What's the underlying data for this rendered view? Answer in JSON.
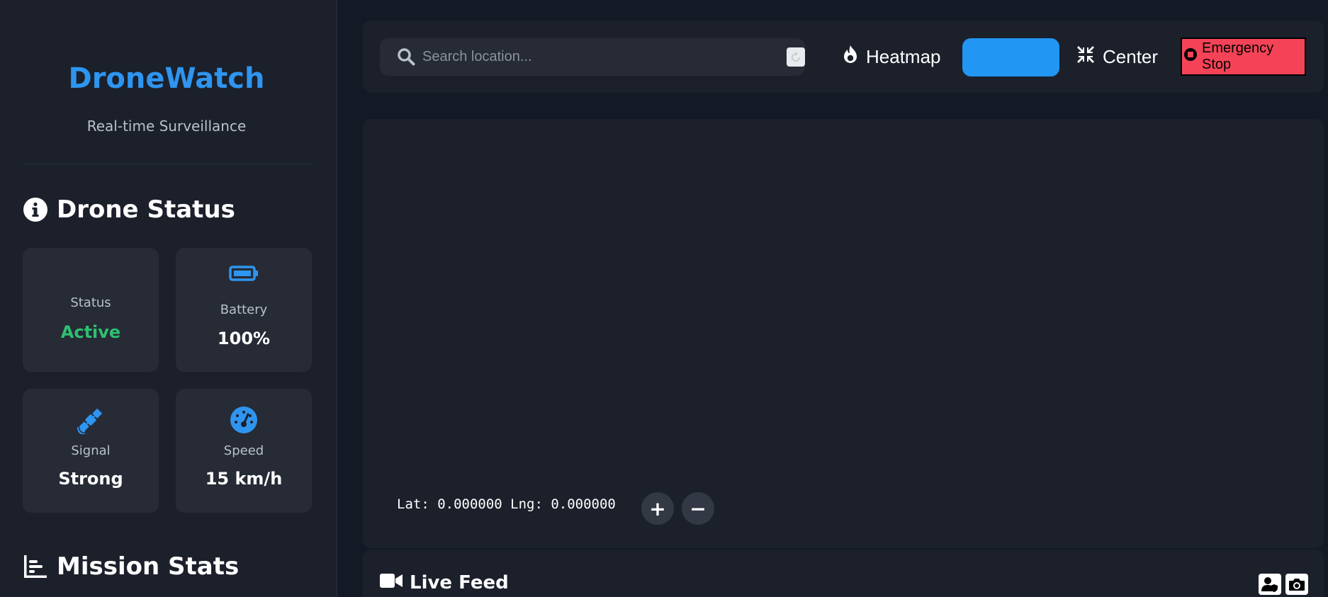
{
  "sidebar": {
    "brand": "DroneWatch",
    "tagline": "Real-time Surveillance",
    "status_section": {
      "title": "Drone Status",
      "icon": "info-circle-icon",
      "cards": [
        {
          "label": "Status",
          "value": "Active",
          "value_color": "#2fbf71"
        },
        {
          "label": "Battery",
          "value": "100%",
          "icon": "battery-icon"
        },
        {
          "label": "Signal",
          "value": "Strong",
          "icon": "satellite-icon"
        },
        {
          "label": "Speed",
          "value": "15 km/h",
          "icon": "speedometer-icon"
        }
      ]
    },
    "mission_section": {
      "title": "Mission Stats",
      "icon": "bar-chart-icon"
    }
  },
  "toolbar": {
    "search": {
      "placeholder": "Search location...",
      "value": ""
    },
    "heatmap_label": "Heatmap",
    "blue_button_label": "",
    "center_label": "Center",
    "emergency_label": "Emergency Stop"
  },
  "map": {
    "coords_text": "Lat: 0.000000 Lng: 0.000000",
    "zoom_in_label": "+",
    "zoom_out_label": "−"
  },
  "live_feed": {
    "title": "Live Feed"
  },
  "colors": {
    "accent": "#2196f3",
    "brand": "#2e95f0",
    "danger": "#f44357",
    "success": "#2fbf71",
    "background": "#141a25",
    "panel": "#1b202b",
    "card": "#262b36"
  }
}
